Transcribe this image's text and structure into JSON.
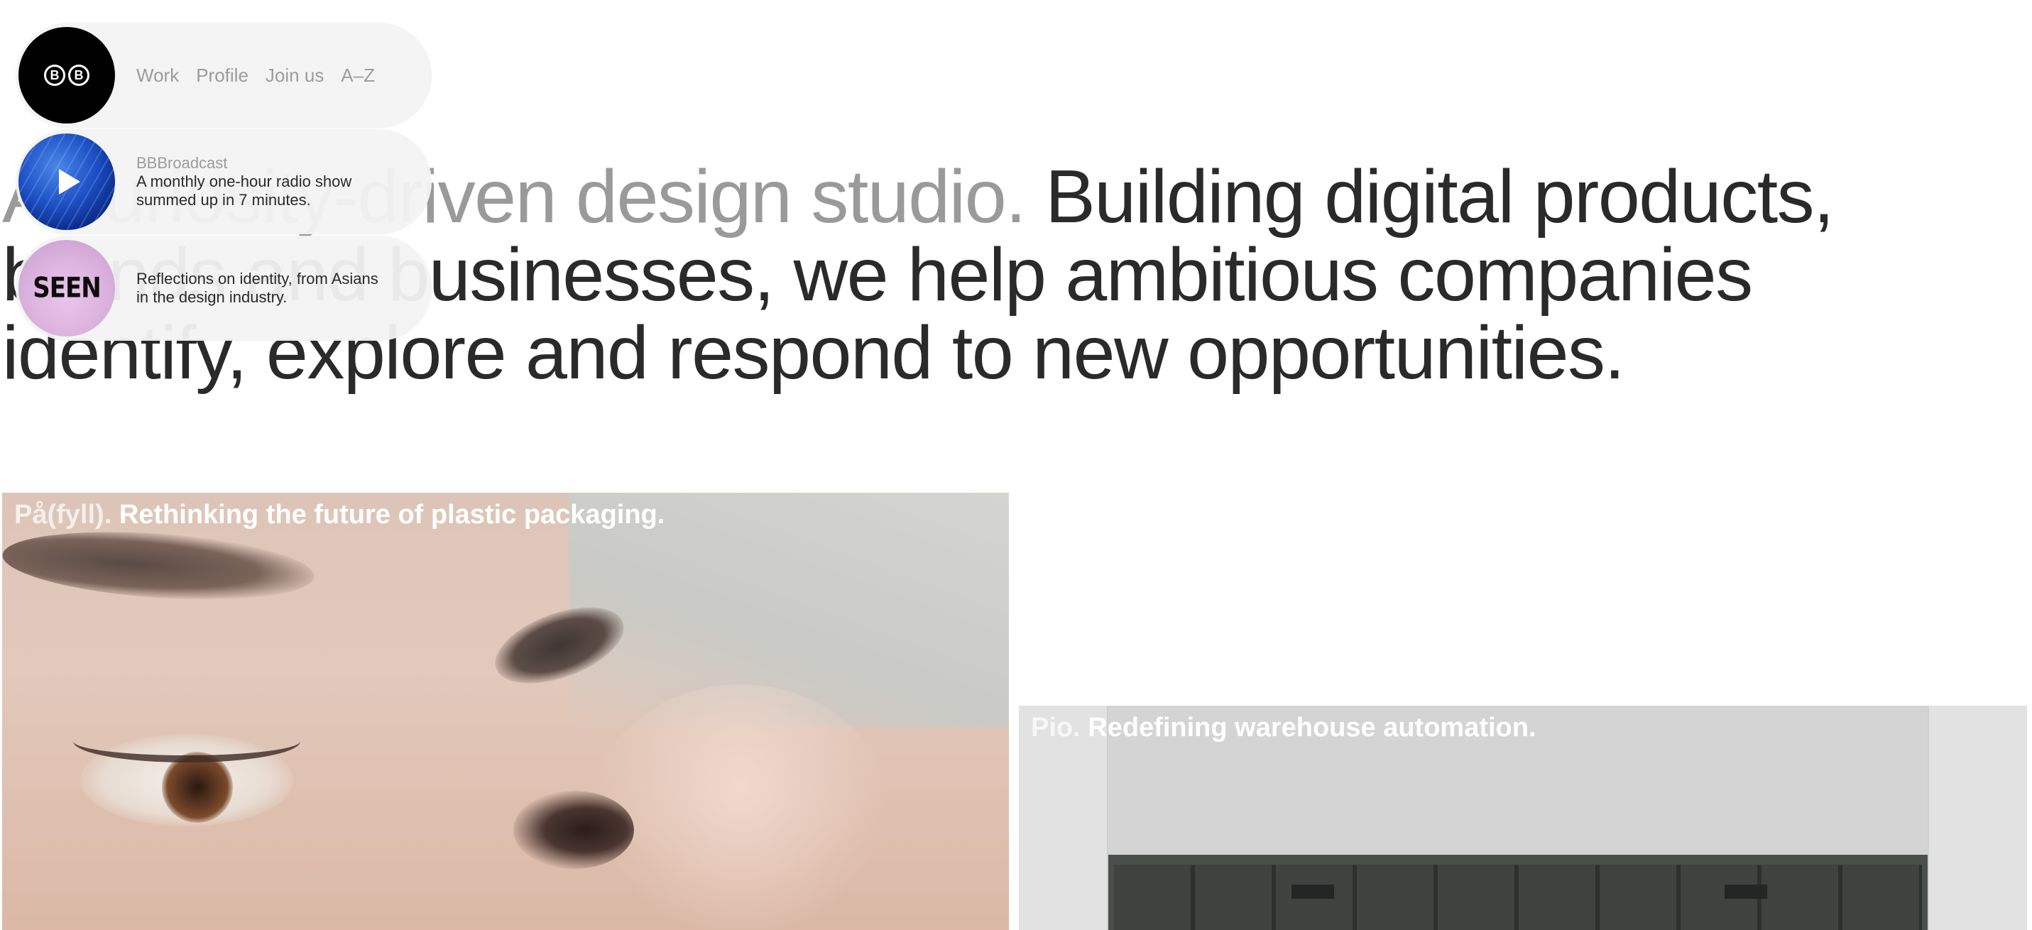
{
  "nav": {
    "logo_label": "BB",
    "links": [
      "Work",
      "Profile",
      "Join us",
      "A–Z"
    ]
  },
  "broadcast": {
    "title": "BBBroadcast",
    "description_line1": "A monthly one-hour radio show",
    "description_line2": "summed up in 7 minutes."
  },
  "seen": {
    "logo_text": "SEEN",
    "description_line1": "Reflections on identity, from Asians",
    "description_line2": "in the design industry."
  },
  "hero": {
    "muted_text": "A curiosity-driven design studio.",
    "main_text": "Building digital products, brands and businesses, we help ambitious companies identify, explore and respond to new opportunities."
  },
  "projects": [
    {
      "name": "På(fyll).",
      "tagline": "Rethinking the future of plastic packaging."
    },
    {
      "name": "Pio.",
      "tagline": "Redefining warehouse automation."
    }
  ],
  "colors": {
    "text": "#2a2a2a",
    "muted": "#9a9a9a",
    "pill_bg": "#f3f3f3"
  }
}
